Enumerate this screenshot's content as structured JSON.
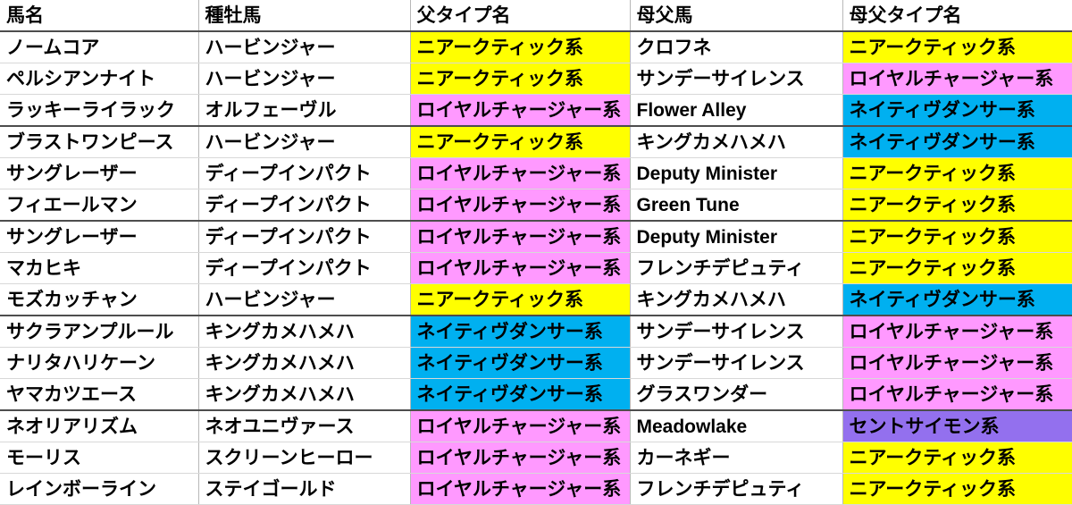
{
  "table": {
    "columns": [
      {
        "label": "馬名"
      },
      {
        "label": "種牡馬"
      },
      {
        "label": "父タイプ名"
      },
      {
        "label": "母父馬"
      },
      {
        "label": "母父タイプ名"
      }
    ],
    "colors": {
      "fill_yellow": "#FFFF00",
      "fill_pink": "#FF99FF",
      "fill_blue": "#00B0F0",
      "fill_purple": "#9370EE",
      "fill_none": "#FFFFFF",
      "text_black": "#000000",
      "text_green": "#00C04B",
      "text_red": "#FF0000",
      "text_cyan": "#35B8F0",
      "grid_line": "#D8D8D8",
      "group_line": "#4D4D4D"
    },
    "rows": [
      {
        "horse": {
          "text": "ノームコア",
          "color": "black",
          "fill": "none"
        },
        "sire": {
          "text": "ハービンジャー",
          "color": "green",
          "fill": "none"
        },
        "sire_type": {
          "text": "ニアークティック系",
          "color": "black",
          "fill": "yellow"
        },
        "broodmare_sire": {
          "text": "クロフネ",
          "color": "black",
          "fill": "none"
        },
        "broodmare_sire_type": {
          "text": "ニアークティック系",
          "color": "black",
          "fill": "yellow"
        },
        "group_end": false
      },
      {
        "horse": {
          "text": "ペルシアンナイト",
          "color": "black",
          "fill": "none"
        },
        "sire": {
          "text": "ハービンジャー",
          "color": "green",
          "fill": "none"
        },
        "sire_type": {
          "text": "ニアークティック系",
          "color": "black",
          "fill": "yellow"
        },
        "broodmare_sire": {
          "text": "サンデーサイレンス",
          "color": "red",
          "fill": "none"
        },
        "broodmare_sire_type": {
          "text": "ロイヤルチャージャー系",
          "color": "black",
          "fill": "pink"
        },
        "group_end": false
      },
      {
        "horse": {
          "text": "ラッキーライラック",
          "color": "black",
          "fill": "none"
        },
        "sire": {
          "text": "オルフェーヴル",
          "color": "black",
          "fill": "none"
        },
        "sire_type": {
          "text": "ロイヤルチャージャー系",
          "color": "black",
          "fill": "pink"
        },
        "broodmare_sire": {
          "text": "Flower Alley",
          "color": "black",
          "fill": "none"
        },
        "broodmare_sire_type": {
          "text": "ネイティヴダンサー系",
          "color": "black",
          "fill": "blue"
        },
        "group_end": true
      },
      {
        "horse": {
          "text": "ブラストワンピース",
          "color": "black",
          "fill": "none"
        },
        "sire": {
          "text": "ハービンジャー",
          "color": "green",
          "fill": "none"
        },
        "sire_type": {
          "text": "ニアークティック系",
          "color": "black",
          "fill": "yellow"
        },
        "broodmare_sire": {
          "text": "キングカメハメハ",
          "color": "black",
          "fill": "none"
        },
        "broodmare_sire_type": {
          "text": "ネイティヴダンサー系",
          "color": "black",
          "fill": "blue"
        },
        "group_end": false
      },
      {
        "horse": {
          "text": "サングレーザー",
          "color": "black",
          "fill": "none"
        },
        "sire": {
          "text": "ディープインパクト",
          "color": "red",
          "fill": "none"
        },
        "sire_type": {
          "text": "ロイヤルチャージャー系",
          "color": "black",
          "fill": "pink"
        },
        "broodmare_sire": {
          "text": "Deputy Minister",
          "color": "black",
          "fill": "none"
        },
        "broodmare_sire_type": {
          "text": "ニアークティック系",
          "color": "black",
          "fill": "yellow"
        },
        "group_end": false
      },
      {
        "horse": {
          "text": "フィエールマン",
          "color": "black",
          "fill": "none"
        },
        "sire": {
          "text": "ディープインパクト",
          "color": "red",
          "fill": "none"
        },
        "sire_type": {
          "text": "ロイヤルチャージャー系",
          "color": "black",
          "fill": "pink"
        },
        "broodmare_sire": {
          "text": "Green Tune",
          "color": "black",
          "fill": "none"
        },
        "broodmare_sire_type": {
          "text": "ニアークティック系",
          "color": "black",
          "fill": "yellow"
        },
        "group_end": true
      },
      {
        "horse": {
          "text": "サングレーザー",
          "color": "black",
          "fill": "none"
        },
        "sire": {
          "text": "ディープインパクト",
          "color": "red",
          "fill": "none"
        },
        "sire_type": {
          "text": "ロイヤルチャージャー系",
          "color": "black",
          "fill": "pink"
        },
        "broodmare_sire": {
          "text": "Deputy Minister",
          "color": "black",
          "fill": "none"
        },
        "broodmare_sire_type": {
          "text": "ニアークティック系",
          "color": "black",
          "fill": "yellow"
        },
        "group_end": false
      },
      {
        "horse": {
          "text": "マカヒキ",
          "color": "black",
          "fill": "none"
        },
        "sire": {
          "text": "ディープインパクト",
          "color": "red",
          "fill": "none"
        },
        "sire_type": {
          "text": "ロイヤルチャージャー系",
          "color": "black",
          "fill": "pink"
        },
        "broodmare_sire": {
          "text": "フレンチデピュティ",
          "color": "black",
          "fill": "none"
        },
        "broodmare_sire_type": {
          "text": "ニアークティック系",
          "color": "black",
          "fill": "yellow"
        },
        "group_end": false
      },
      {
        "horse": {
          "text": "モズカッチャン",
          "color": "black",
          "fill": "none"
        },
        "sire": {
          "text": "ハービンジャー",
          "color": "green",
          "fill": "none"
        },
        "sire_type": {
          "text": "ニアークティック系",
          "color": "black",
          "fill": "yellow"
        },
        "broodmare_sire": {
          "text": "キングカメハメハ",
          "color": "black",
          "fill": "none"
        },
        "broodmare_sire_type": {
          "text": "ネイティヴダンサー系",
          "color": "black",
          "fill": "blue"
        },
        "group_end": true
      },
      {
        "horse": {
          "text": "サクラアンプルール",
          "color": "black",
          "fill": "none"
        },
        "sire": {
          "text": "キングカメハメハ",
          "color": "cyan",
          "fill": "none"
        },
        "sire_type": {
          "text": "ネイティヴダンサー系",
          "color": "black",
          "fill": "blue"
        },
        "broodmare_sire": {
          "text": "サンデーサイレンス",
          "color": "red",
          "fill": "none"
        },
        "broodmare_sire_type": {
          "text": "ロイヤルチャージャー系",
          "color": "black",
          "fill": "pink"
        },
        "group_end": false
      },
      {
        "horse": {
          "text": "ナリタハリケーン",
          "color": "black",
          "fill": "none"
        },
        "sire": {
          "text": "キングカメハメハ",
          "color": "cyan",
          "fill": "none"
        },
        "sire_type": {
          "text": "ネイティヴダンサー系",
          "color": "black",
          "fill": "blue"
        },
        "broodmare_sire": {
          "text": "サンデーサイレンス",
          "color": "red",
          "fill": "none"
        },
        "broodmare_sire_type": {
          "text": "ロイヤルチャージャー系",
          "color": "black",
          "fill": "pink"
        },
        "group_end": false
      },
      {
        "horse": {
          "text": "ヤマカツエース",
          "color": "black",
          "fill": "none"
        },
        "sire": {
          "text": "キングカメハメハ",
          "color": "cyan",
          "fill": "none"
        },
        "sire_type": {
          "text": "ネイティヴダンサー系",
          "color": "black",
          "fill": "blue"
        },
        "broodmare_sire": {
          "text": "グラスワンダー",
          "color": "black",
          "fill": "none"
        },
        "broodmare_sire_type": {
          "text": "ロイヤルチャージャー系",
          "color": "black",
          "fill": "pink"
        },
        "group_end": true
      },
      {
        "horse": {
          "text": "ネオリアリズム",
          "color": "black",
          "fill": "none"
        },
        "sire": {
          "text": "ネオユニヴァース",
          "color": "black",
          "fill": "none"
        },
        "sire_type": {
          "text": "ロイヤルチャージャー系",
          "color": "black",
          "fill": "pink"
        },
        "broodmare_sire": {
          "text": "Meadowlake",
          "color": "black",
          "fill": "none"
        },
        "broodmare_sire_type": {
          "text": "セントサイモン系",
          "color": "black",
          "fill": "purple"
        },
        "group_end": false
      },
      {
        "horse": {
          "text": "モーリス",
          "color": "black",
          "fill": "none"
        },
        "sire": {
          "text": "スクリーンヒーロー",
          "color": "black",
          "fill": "none"
        },
        "sire_type": {
          "text": "ロイヤルチャージャー系",
          "color": "black",
          "fill": "pink"
        },
        "broodmare_sire": {
          "text": "カーネギー",
          "color": "black",
          "fill": "none"
        },
        "broodmare_sire_type": {
          "text": "ニアークティック系",
          "color": "black",
          "fill": "yellow"
        },
        "group_end": false
      },
      {
        "horse": {
          "text": "レインボーライン",
          "color": "black",
          "fill": "none"
        },
        "sire": {
          "text": "ステイゴールド",
          "color": "black",
          "fill": "none"
        },
        "sire_type": {
          "text": "ロイヤルチャージャー系",
          "color": "black",
          "fill": "pink"
        },
        "broodmare_sire": {
          "text": "フレンチデピュティ",
          "color": "black",
          "fill": "none"
        },
        "broodmare_sire_type": {
          "text": "ニアークティック系",
          "color": "black",
          "fill": "yellow"
        },
        "group_end": false
      }
    ]
  }
}
